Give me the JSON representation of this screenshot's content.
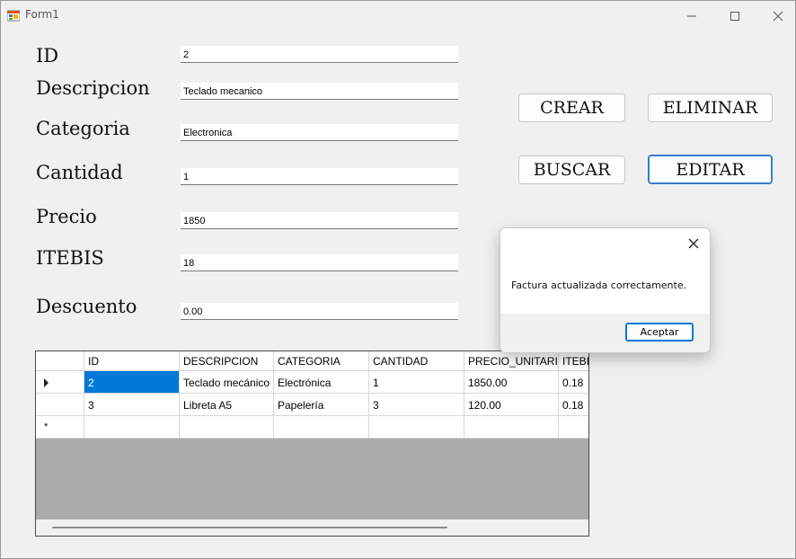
{
  "window": {
    "title": "Form1"
  },
  "labels": {
    "id": "ID",
    "descripcion": "Descripcion",
    "categoria": "Categoria",
    "cantidad": "Cantidad",
    "precio": "Precio",
    "itebis": "ITEBIS",
    "descuento": "Descuento"
  },
  "fields": {
    "id": "2",
    "descripcion": "Teclado mecanico",
    "categoria": "Electronica",
    "cantidad": "1",
    "precio": "1850",
    "itebis": "18",
    "descuento": "0.00"
  },
  "buttons": {
    "crear": "CREAR",
    "eliminar": "ELIMINAR",
    "buscar": "BUSCAR",
    "editar": "EDITAR"
  },
  "grid": {
    "columns": [
      "ID",
      "DESCRIPCION",
      "CATEGORIA",
      "CANTIDAD",
      "PRECIO_UNITARIO",
      "ITEBIS"
    ],
    "rows": [
      [
        "2",
        "Teclado mecánico",
        "Electrónica",
        "1",
        "1850.00",
        "0.18"
      ],
      [
        "3",
        "Libreta A5",
        "Papelería",
        "3",
        "120.00",
        "0.18"
      ]
    ],
    "selected_row": 0,
    "new_row_marker": "*"
  },
  "dialog": {
    "message": "Factura actualizada correctamente.",
    "ok_label": "Aceptar"
  }
}
